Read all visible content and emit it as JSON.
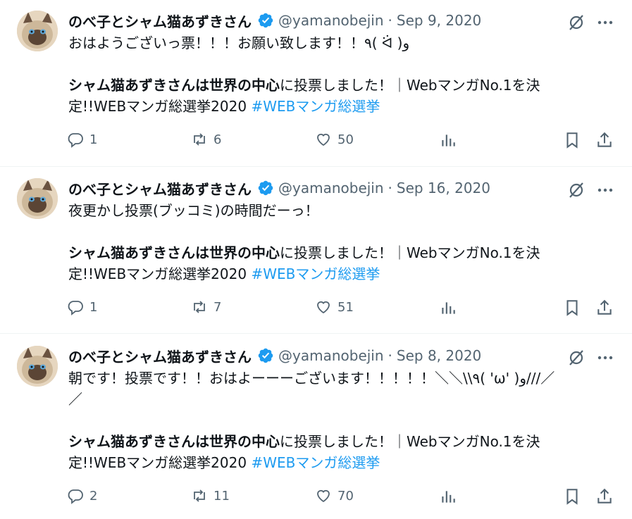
{
  "tweets": [
    {
      "name": "のべ子とシャム猫あずきさん",
      "handle": "@yamanobejin",
      "separator": "·",
      "date": "Sep 9, 2020",
      "line1": "おはようございっ票！！！お願い致します！！٩( ᐛ )و",
      "bold_part": "シャム猫あずきさんは世界の中心",
      "rest_line2a": "に投票しました！｜WebマンガNo.1を決",
      "line3": "定!!WEBマンガ総選挙2020 ",
      "hashtag": "#WEBマンガ総選挙",
      "replies": "1",
      "retweets": "6",
      "likes": "50"
    },
    {
      "name": "のべ子とシャム猫あずきさん",
      "handle": "@yamanobejin",
      "separator": "·",
      "date": "Sep 16, 2020",
      "line1": "夜更かし投票(ブッコミ)の時間だーっ！",
      "bold_part": "シャム猫あずきさんは世界の中心",
      "rest_line2a": "に投票しました！｜WebマンガNo.1を決",
      "line3": "定!!WEBマンガ総選挙2020 ",
      "hashtag": "#WEBマンガ総選挙",
      "replies": "1",
      "retweets": "7",
      "likes": "51"
    },
    {
      "name": "のべ子とシャム猫あずきさん",
      "handle": "@yamanobejin",
      "separator": "·",
      "date": "Sep 8, 2020",
      "line1": "朝です！投票です！！おはよーーーございます！！！！！＼＼\\\\٩( 'ω' )و///／",
      "line1b": "／",
      "bold_part": "シャム猫あずきさんは世界の中心",
      "rest_line2a": "に投票しました！｜WebマンガNo.1を決",
      "line3": "定!!WEBマンガ総選挙2020 ",
      "hashtag": "#WEBマンガ総選挙",
      "replies": "2",
      "retweets": "11",
      "likes": "70"
    }
  ],
  "colors": {
    "verified": "#1d9bf0",
    "hashtag": "#1d9bf0",
    "meta": "#536471"
  },
  "icons": [
    "verified-badge-icon",
    "grok-icon",
    "more-icon",
    "reply-icon",
    "retweet-icon",
    "like-icon",
    "views-icon",
    "bookmark-icon",
    "share-icon"
  ]
}
